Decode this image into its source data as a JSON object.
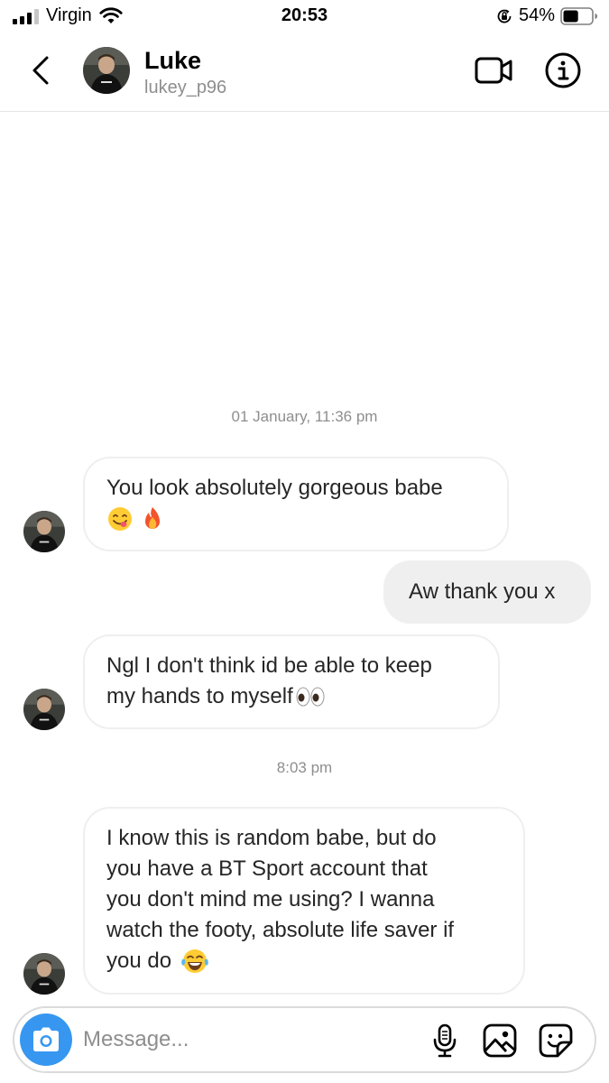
{
  "status_bar": {
    "carrier": "Virgin",
    "time": "20:53",
    "battery_percent": "54%",
    "battery_level": 0.54
  },
  "header": {
    "name": "Luke",
    "username": "lukey_p96"
  },
  "timestamps": {
    "first": "01 January, 11:36 pm",
    "second": "8:03 pm"
  },
  "messages": [
    {
      "direction": "incoming",
      "line1": "You look absolutely gorgeous babe",
      "emojis": [
        "yum-face-emoji",
        "fire-emoji"
      ]
    },
    {
      "direction": "outgoing",
      "text": "Aw thank you x"
    },
    {
      "direction": "incoming",
      "line1": "Ngl I don't think id be able to keep",
      "line2": "my hands to myself",
      "emojis": [
        "eyes-emoji"
      ]
    },
    {
      "direction": "incoming",
      "line1": "I know this is random babe, but do",
      "line2": "you have a BT Sport account that",
      "line3": "you don't mind me using? I wanna",
      "line4": "watch the footy, absolute life saver if",
      "line5": "you do",
      "emojis": [
        "tears-of-joy-emoji"
      ]
    }
  ],
  "composer": {
    "placeholder": "Message..."
  },
  "colors": {
    "accent": "#3797f0",
    "outgoing_bubble": "#efefef",
    "secondary_text": "#8e8e8e"
  }
}
